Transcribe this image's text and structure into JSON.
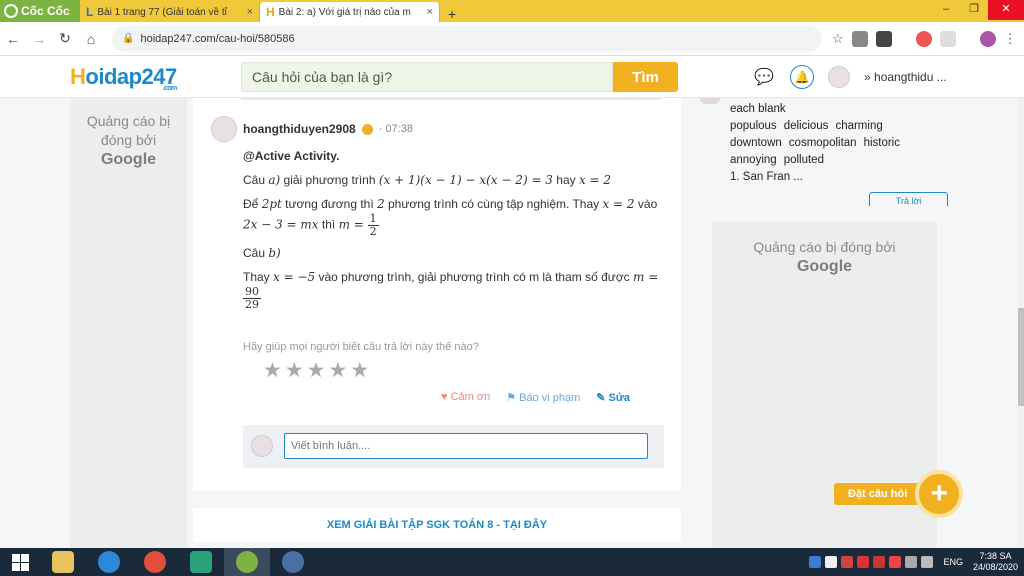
{
  "browser": {
    "brand": "Cốc Cốc",
    "tabs": [
      {
        "favicon": "L",
        "title": "Bài 1 trang 77 (Giải toán về tỉ",
        "close": "×",
        "active": false
      },
      {
        "favicon": "H",
        "title": "Bài 2: a) Với giá trị nào của m",
        "close": "×",
        "active": true
      }
    ],
    "new_tab": "+",
    "window_controls": {
      "minimize": "–",
      "maximize": "❐",
      "close": "✕"
    },
    "nav": {
      "back": "←",
      "forward": "→",
      "reload": "↻",
      "home": "⌂"
    },
    "url": "hoidap247.com/cau-hoi/580586"
  },
  "site": {
    "logo_letter": "H",
    "logo_rest": "oidap247",
    "logo_suffix": ".com",
    "search_placeholder": "Câu hỏi của bạn là gì?",
    "search_button": "Tìm",
    "username": "hoangthidu ..."
  },
  "left_ad": {
    "line1": "Quảng cáo bị",
    "line2": "đóng bởi",
    "brand": "Google"
  },
  "answer": {
    "author": "hoangthiduyen2908",
    "time": "· 07:38",
    "mention": "@Active Activity.",
    "line_a_prefix": "Câu ",
    "line_a_var": "a)",
    "line_a_text": " giải phương trình ",
    "eq1": "(x + 1)(x − 1) − x(x − 2) = 3",
    "line_a_mid": " hay ",
    "eq1_res": "x = 2",
    "p2_prefix": "Để ",
    "p2_var": "2pt",
    "p2_text1": " tương đương thì ",
    "p2_two": "2",
    "p2_text2": " phương trình có cùng tập nghiệm. Thay ",
    "p2_x": "x = 2",
    "p2_text3": " vào ",
    "p2_eq": "2x − 3 = mx",
    "p2_text4": " thì ",
    "p2_m": "m = ",
    "p2_num": "1",
    "p2_den": "2",
    "b_prefix": "Câu ",
    "b_var": "b)",
    "p4_prefix": "Thay ",
    "p4_x": "x = −5",
    "p4_text": " vào phương trình, giải phương trình có m là tham số được ",
    "p4_m": "m =",
    "p4_num": "90",
    "p4_den": "29",
    "rate_question": "Hãy giúp mọi người biết câu trả lời này thế nào?",
    "stars": "★",
    "thanks": "♥ Cảm ơn",
    "report": "⚑ Báo vi phạm",
    "edit": "✎ Sửa",
    "comment_placeholder": "Viết bình luận...."
  },
  "bottom_link": "XEM GIẢI BÀI TẬP SGK TOÁN 8 - TẠI ĐÂY",
  "right_column": {
    "line1": "each blank",
    "words_row1": [
      "populous",
      "delicious",
      "charming"
    ],
    "words_row2": [
      "downtown",
      "cosmopolitan",
      "historic"
    ],
    "words_row3": [
      "annoying",
      "polluted"
    ],
    "line_last": "1. San Fran ...",
    "answer_button": "Trả lời"
  },
  "right_ad": {
    "line1": "Quảng cáo bị đóng bởi",
    "brand": "Google"
  },
  "fab": {
    "label": "Đặt câu hỏi",
    "icon": "+"
  },
  "taskbar": {
    "lang": "ENG",
    "time": "7:38 SA",
    "date": "24/08/2020"
  },
  "colors": {
    "brand_yellow": "#f0b020",
    "brand_blue": "#1e88c8",
    "tabbar": "#f0c93a",
    "taskbar": "#1b2a3a"
  }
}
